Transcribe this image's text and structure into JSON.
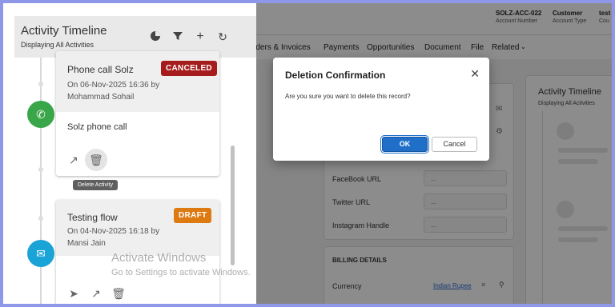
{
  "record": {
    "account_number": "SOLZ-ACC-022",
    "account_number_label": "Account Number",
    "account_type": "Customer",
    "account_type_label": "Account Type",
    "extra_value": "test",
    "extra_label": "Cou"
  },
  "tabs": [
    "rders & Invoices",
    "Payments",
    "Opportunities",
    "Document",
    "File",
    "Related"
  ],
  "social": [
    {
      "label": "FaceBook URL",
      "value": "..."
    },
    {
      "label": "Twitter URL",
      "value": "..."
    },
    {
      "label": "Instagram Handle",
      "value": "..."
    }
  ],
  "billing": {
    "section_title": "BILLING DETAILS",
    "currency_label": "Currency",
    "currency_value": "Indian Rupee"
  },
  "right_timeline": {
    "title": "Activity Timeline",
    "subtitle": "Displaying All Activities"
  },
  "timeline": {
    "title": "Activity Timeline",
    "subtitle": "Displaying All Activities",
    "activities": [
      {
        "title": "Phone call Solz",
        "status": "CANCELED",
        "status_color": "#a61c1c",
        "date": "On 06-Nov-2025 16:36 by",
        "user": "Mohammad Sohail",
        "body": "Solz phone call",
        "icon": "phone-icon",
        "icon_color": "#3aa64a"
      },
      {
        "title": "Testing flow",
        "status": "DRAFT",
        "status_color": "#dd7a12",
        "date": "On 04-Nov-2025 16:18 by",
        "user": "Mansi Jain",
        "icon": "mail-icon",
        "icon_color": "#1aa3d7"
      }
    ],
    "tooltip": "Delete Activity"
  },
  "watermark": {
    "line1": "Activate Windows",
    "line2": "Go to Settings to activate Windows."
  },
  "modal": {
    "title": "Deletion Confirmation",
    "message": "Are you sure you want to delete this record?",
    "ok_label": "OK",
    "cancel_label": "Cancel"
  }
}
